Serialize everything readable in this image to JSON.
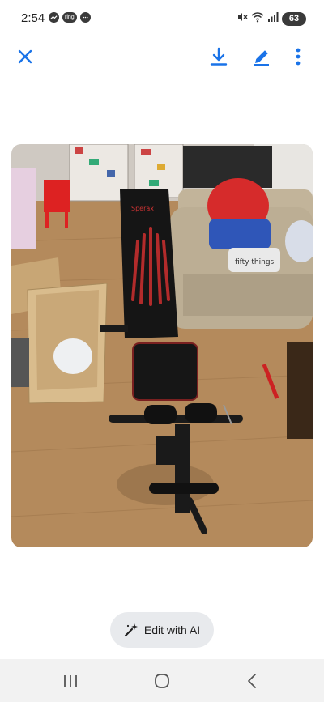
{
  "status_bar": {
    "time": "2:54",
    "notification_pill": "ring",
    "battery": "63"
  },
  "toolbar": {
    "close_icon": "close-icon",
    "download_icon": "download-icon",
    "edit_icon": "pencil-icon",
    "more_icon": "more-vert-icon"
  },
  "photo": {
    "brand_text": "Sperax",
    "pillow_text": "fifty things"
  },
  "edit_ai": {
    "label": "Edit with AI",
    "icon": "sparkle-pen-icon"
  },
  "nav": {
    "recents_icon": "recents-icon",
    "home_icon": "home-icon",
    "back_icon": "back-icon"
  },
  "colors": {
    "accent_blue": "#1a73e8",
    "pill_bg": "#e8eaed",
    "nav_bg": "#f2f2f2"
  }
}
